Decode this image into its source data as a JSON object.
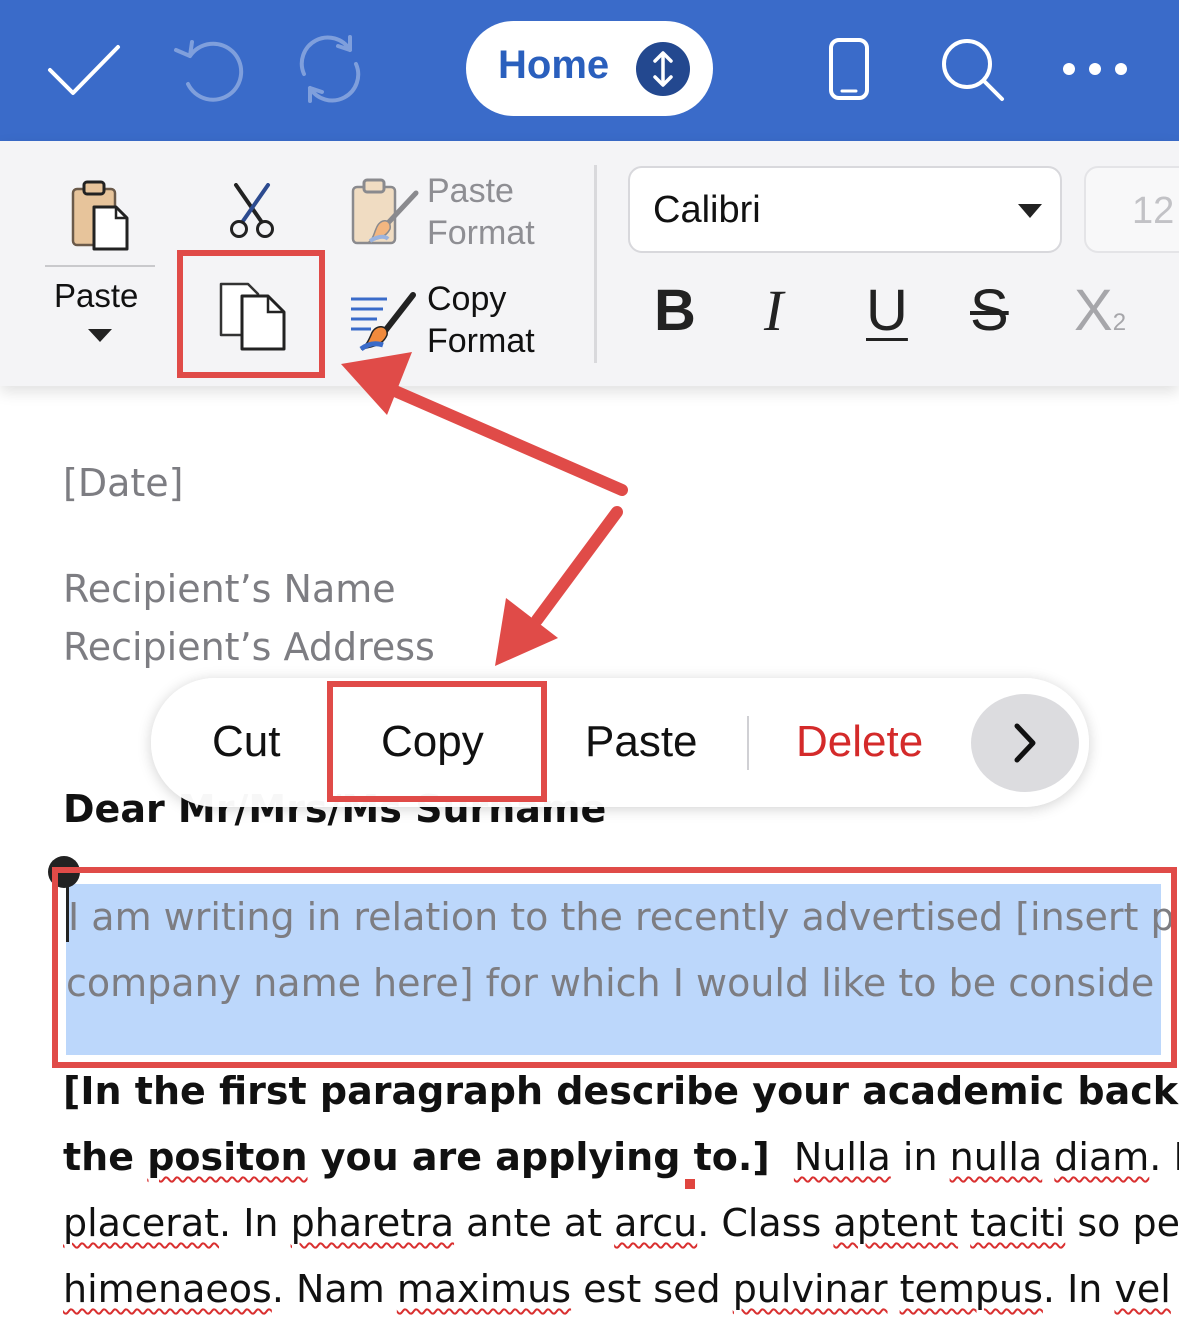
{
  "toolbar": {
    "done_icon": "checkmark-icon",
    "undo_icon": "undo-icon",
    "redo_icon": "redo-icon",
    "home_label": "Home",
    "home_toggle_icon": "updown-arrows-icon",
    "device_icon": "phone-icon",
    "search_icon": "search-icon",
    "more_icon": "ellipsis-icon",
    "background_color": "#3a6bc9"
  },
  "ribbon": {
    "paste_label": "Paste",
    "cut_icon": "scissors-icon",
    "copy_icon": "copy-icon",
    "paste_format_line1": "Paste",
    "paste_format_line2": "Format",
    "copy_format_line1": "Copy",
    "copy_format_line2": "Format",
    "font_name": "Calibri",
    "font_size": "12",
    "bold": "B",
    "italic": "I",
    "underline": "U",
    "strikethrough": "S",
    "subscript_base": "X",
    "subscript_digit": "2"
  },
  "document": {
    "date": "[Date]",
    "recipient_name": "Recipient’s Name",
    "recipient_address": "Recipient’s Address",
    "salutation": "Dear Mr/Mrs/Ms Surname",
    "selected_line1": "I am writing in relation to the recently advertised [insert p",
    "selected_line2": "company name here] for which I would like to be conside",
    "para_line1": "[In the first paragraph describe your academic backgroun",
    "para_line2_bold_a": "the ",
    "para_line2_bold_b": "positon",
    "para_line2_bold_c": " you are applying to.]",
    "para_line2_sp": "  ",
    "para_line2_w1": "Nulla",
    "para_line2_t1": " in ",
    "para_line2_w2": "nulla",
    "para_line2_t2": " ",
    "para_line2_w3": "diam",
    "para_line2_t3": ". Mae",
    "para_line3_w1": "placerat",
    "para_line3_t1": ". In ",
    "para_line3_w2": "pharetra",
    "para_line3_t2": " ante at ",
    "para_line3_w3": "arcu",
    "para_line3_t3": ". Class ",
    "para_line3_w4": "aptent",
    "para_line3_t4": " ",
    "para_line3_w5": "taciti",
    "para_line3_t5": " so per",
    "para_line4_w1": "himenaeos",
    "para_line4_t1": ". Nam ",
    "para_line4_w2": "maximus",
    "para_line4_t2": " est sed ",
    "para_line4_w3": "pulvinar",
    "para_line4_t3": " ",
    "para_line4_w4": "tempus",
    "para_line4_t4": ". In ",
    "para_line4_w5": "vel"
  },
  "context_menu": {
    "cut": "Cut",
    "copy": "Copy",
    "paste": "Paste",
    "delete": "Delete",
    "more_icon": "chevron-right-icon",
    "delete_color": "#d42a2a"
  },
  "annotations": {
    "highlight_color": "#e04b48",
    "selection_color": "#bcd7fb"
  }
}
